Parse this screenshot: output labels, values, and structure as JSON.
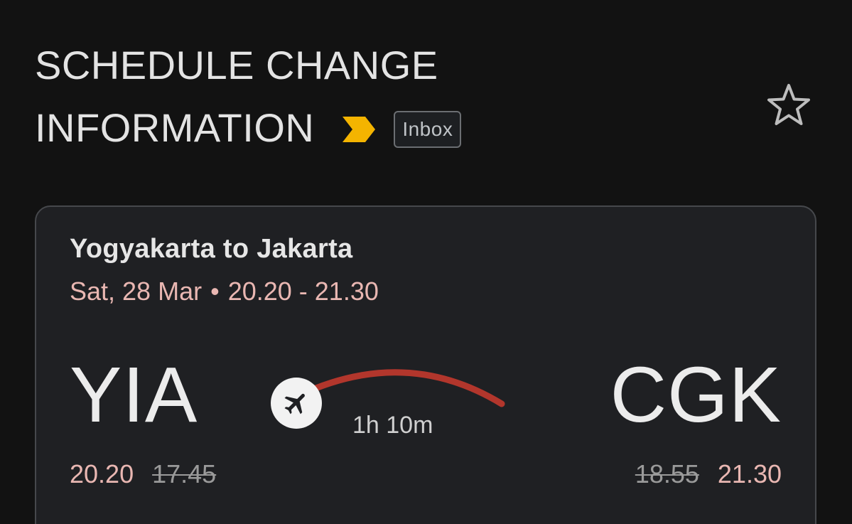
{
  "email": {
    "subject_line1": "SCHEDULE CHANGE",
    "subject_line2": "INFORMATION",
    "label": "Inbox",
    "importance_color": "#f4b400",
    "icons": {
      "importance": "importance-marker-icon",
      "star": "star-outline-icon",
      "plane": "airplane-icon"
    }
  },
  "flight": {
    "route": "Yogyakarta to Jakarta",
    "date": "Sat, 28 Mar",
    "separator": "•",
    "time_range": "20.20 - 21.30",
    "origin_code": "YIA",
    "destination_code": "CGK",
    "duration": "1h 10m",
    "origin_new_time": "20.20",
    "origin_old_time": "17.45",
    "destination_old_time": "18.55",
    "destination_new_time": "21.30",
    "arc_color": "#b2362c",
    "accent_color": "#e9b7b2"
  }
}
